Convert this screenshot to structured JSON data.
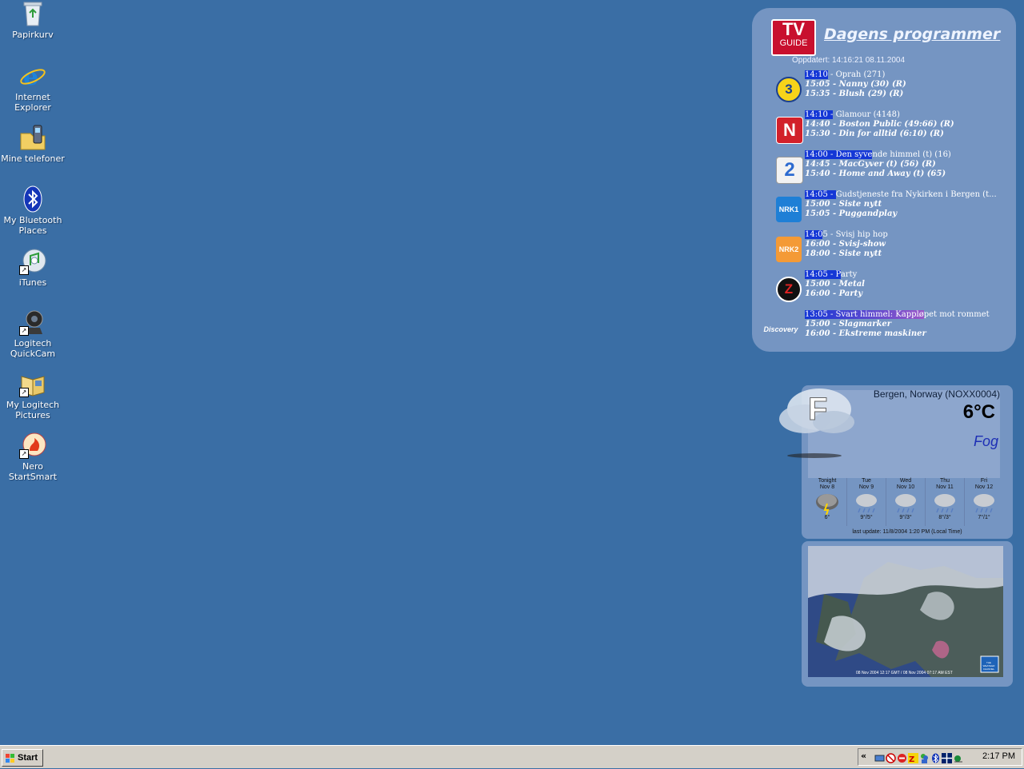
{
  "desktop": {
    "icons": [
      {
        "label": "Papirkurv",
        "icon": "recycle-bin-icon"
      },
      {
        "label": "Internet\nExplorer",
        "icon": "internet-explorer-icon"
      },
      {
        "label": "Mine telefoner",
        "icon": "my-phones-icon"
      },
      {
        "label": "My Bluetooth\nPlaces",
        "icon": "bluetooth-icon"
      },
      {
        "label": "iTunes",
        "icon": "itunes-icon"
      },
      {
        "label": "Logitech\nQuickCam",
        "icon": "webcam-icon"
      },
      {
        "label": "My Logitech\nPictures",
        "icon": "pictures-folder-icon"
      },
      {
        "label": "Nero StartSmart",
        "icon": "nero-icon"
      }
    ]
  },
  "tvguide": {
    "logo_top": "TV",
    "logo_bottom": "GUIDE",
    "title": "Dagens programmer",
    "updated": "Oppdatert: 14:16:21 08.11.2004",
    "channels": [
      {
        "icon": "tv3-logo",
        "logo": "3",
        "now_time": "14:10",
        "now_rest": " - Oprah (271)",
        "next1": "15:05 - Nanny (30) (R)",
        "next2": "15:35 - Blush (29) (R)"
      },
      {
        "icon": "tvnorge-logo",
        "logo": "N",
        "now_time": "14:10 -",
        "now_rest": " Glamour (4148)",
        "next1": "14:40 - Boston Public (49:66) (R)",
        "next2": "15:30 - Din for alltid (6:10) (R)"
      },
      {
        "icon": "tv2-logo",
        "logo": "2",
        "now_time": "14:00 - Den syve",
        "now_rest": "nde himmel (t)  (16)",
        "next1": "14:45 - MacGyver (t)  (56) (R)",
        "next2": "15:40 - Home and Away (t)  (65)"
      },
      {
        "icon": "nrk1-logo",
        "logo": "NRK1",
        "now_time": "14:05 - ",
        "now_rest": "Gudstjeneste fra Nykirken i Bergen (t...",
        "next1": "15:00 - Siste nytt",
        "next2": "15:05 - Puggandplay"
      },
      {
        "icon": "nrk2-logo",
        "logo": "NRK2",
        "now_time": "14:0",
        "now_rest": "5 - Svisj hip hop",
        "next1": "16:00 - Svisj-show",
        "next2": "18:00 - Siste nytt"
      },
      {
        "icon": "zdf-logo",
        "logo": "Z",
        "now_time": "14:05 - P",
        "now_rest": "arty",
        "next1": "15:00 - Metal",
        "next2": "16:00 - Party"
      },
      {
        "icon": "discovery-logo",
        "logo": "Discovery",
        "now_time": "13:05 - Svart himmel: Kapplø",
        "now_rest": "pet mot rommet",
        "next1": "15:00 - Slagmarker",
        "next2": "16:00 - Ekstreme maskiner"
      }
    ]
  },
  "weather": {
    "icon_letter": "F",
    "location": "Bergen, Norway (NOXX0004)",
    "temp": "6°C",
    "condition": "Fog",
    "forecast": [
      {
        "day": "Tonight",
        "date": "Nov 8",
        "temps": "6°"
      },
      {
        "day": "Tue",
        "date": "Nov 9",
        "temps": "9°/5°"
      },
      {
        "day": "Wed",
        "date": "Nov 10",
        "temps": "9°/3°"
      },
      {
        "day": "Thu",
        "date": "Nov 11",
        "temps": "8°/3°"
      },
      {
        "day": "Fri",
        "date": "Nov 12",
        "temps": "7°/1°"
      }
    ],
    "last_update": "last update: 11/8/2004 1:20 PM (Local Time)"
  },
  "map": {
    "caption": "08 Nov 2004 12:17 GMT / 08 Nov 2004 07:17 AM EST",
    "badge": "THE WEATHER CHANNEL"
  },
  "taskbar": {
    "start_label": "Start",
    "tray_arrow": "«",
    "clock": "2:17 PM",
    "tray_icons": [
      "network-icon",
      "norton-icon",
      "no-entry-icon",
      "zonealarm-icon",
      "messenger-icon",
      "bluetooth-tray-icon",
      "flag-icon",
      "weather-tray-icon"
    ]
  },
  "colors": {
    "desktop": "#3a6ea5",
    "highlight": "#1437d6",
    "taskbar": "#d4d0c8"
  }
}
